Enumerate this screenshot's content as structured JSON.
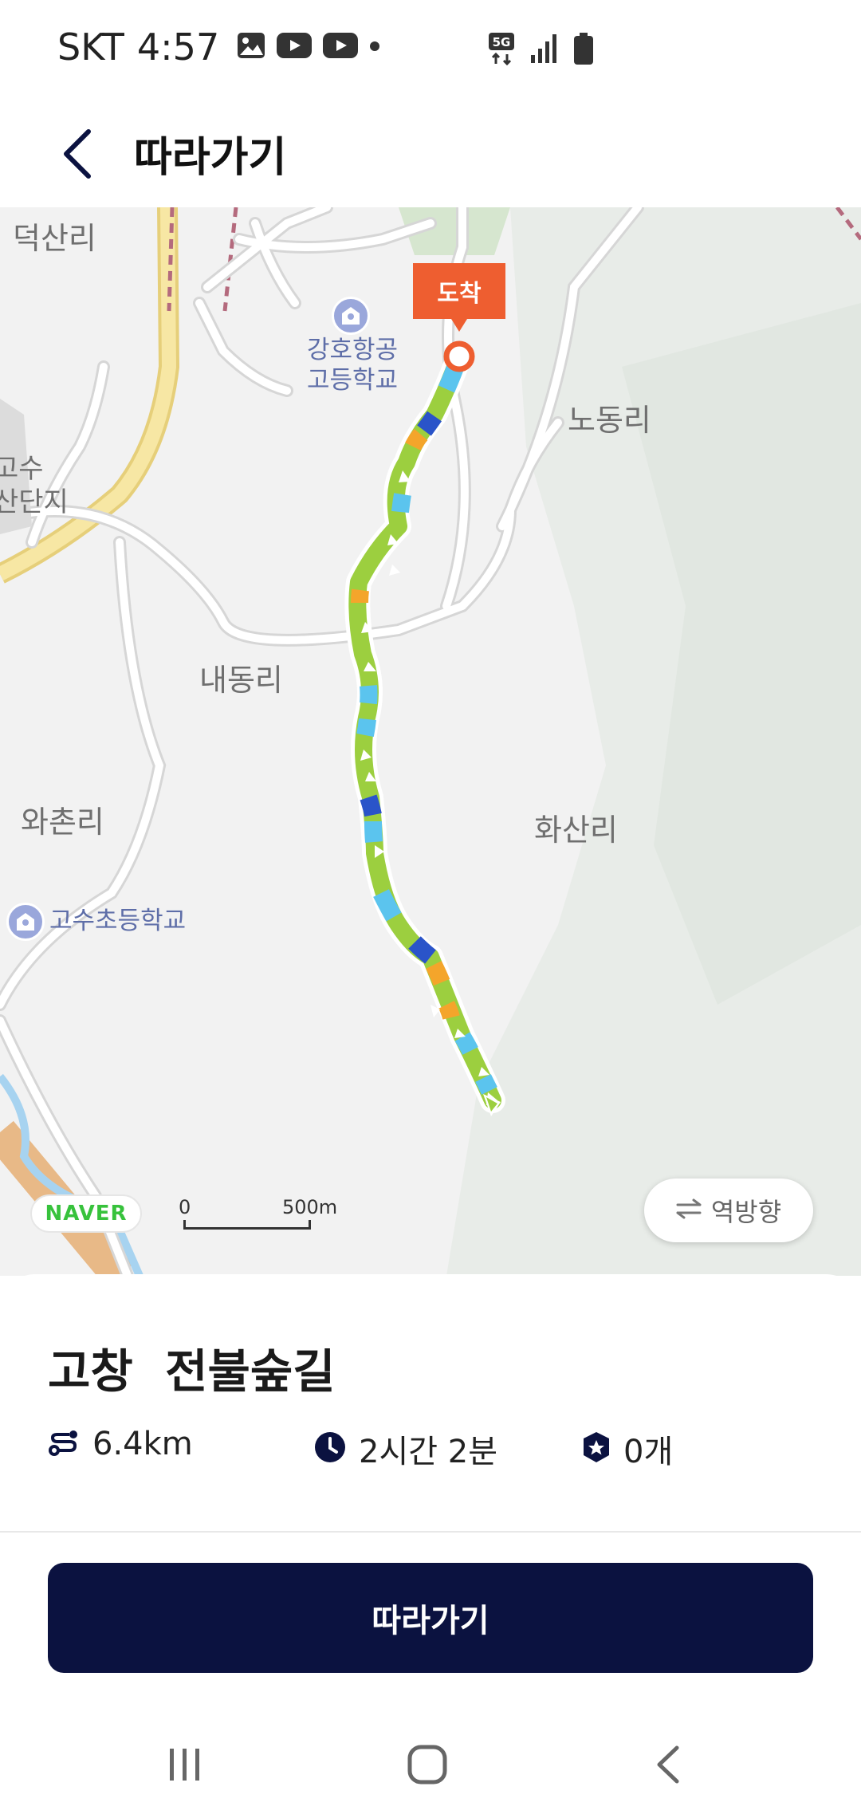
{
  "status_bar": {
    "carrier": "SKT",
    "time": "4:57",
    "network": "5G",
    "icons_left": [
      "gallery-icon",
      "youtube-icon",
      "youtube-icon",
      "dot-icon"
    ],
    "icons_right": [
      "network-5g-icon",
      "signal-icon",
      "battery-icon"
    ]
  },
  "header": {
    "title": "따라가기",
    "back_icon": "chevron-left-icon"
  },
  "map": {
    "place_labels": [
      "덕산리",
      "노동리",
      "내동리",
      "와촌리",
      "화산리",
      "고수",
      "산단지"
    ],
    "pois": [
      {
        "name_line1": "강호항공",
        "name_line2": "고등학교"
      },
      {
        "name": "고수초등학교"
      }
    ],
    "arrival_flag": "도착",
    "provider_logo": "NAVER",
    "scale": {
      "zero": "0",
      "distance": "500m"
    },
    "reverse_button": {
      "icon": "swap-arrows-icon",
      "label": "역방향"
    },
    "colors": {
      "route_green": "#9ccf3f",
      "route_blue": "#5bc4ee",
      "route_dark_blue": "#2a54c9",
      "route_orange": "#f4a52b",
      "arrival_red": "#ee5e30",
      "road_yellow": "#f6e39a"
    }
  },
  "sheet": {
    "course_title": "고창  전불숲길",
    "stats": [
      {
        "icon": "route-icon",
        "value": "6.4km"
      },
      {
        "icon": "clock-icon",
        "value": "2시간 2분"
      },
      {
        "icon": "stamp-star-icon",
        "value": "0개"
      }
    ],
    "follow_button": "따라가기",
    "colors": {
      "button_bg": "#0b1240",
      "button_text": "#ffffff"
    }
  },
  "nav_bar": {
    "icons": [
      "recent-apps-icon",
      "home-icon",
      "back-icon"
    ]
  }
}
